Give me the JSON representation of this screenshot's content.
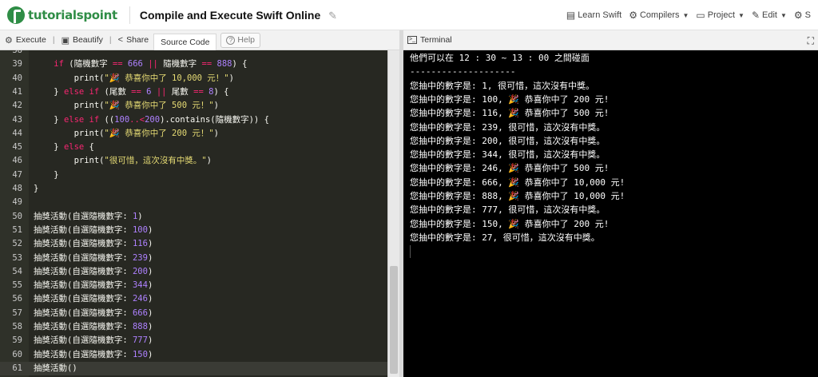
{
  "header": {
    "logo_text": "tutorialspoint",
    "title": "Compile and Execute Swift Online",
    "nav": [
      {
        "icon": "book-icon",
        "glyph": "▤",
        "label": "Learn Swift",
        "caret": false
      },
      {
        "icon": "gear-icon",
        "glyph": "⚙",
        "label": "Compilers",
        "caret": true
      },
      {
        "icon": "folder-icon",
        "glyph": "▭",
        "label": "Project",
        "caret": true
      },
      {
        "icon": "pencil-icon",
        "glyph": "✎",
        "label": "Edit",
        "caret": true
      },
      {
        "icon": "settings-icon",
        "glyph": "⚙",
        "label": "S",
        "caret": false
      }
    ]
  },
  "toolbar": {
    "execute_label": "Execute",
    "beautify_label": "Beautify",
    "share_label": "Share",
    "source_code_tab": "Source Code",
    "help_label": "Help"
  },
  "editor": {
    "active_line": 62,
    "lines": [
      {
        "n": "38",
        "segs": []
      },
      {
        "n": "39",
        "segs": [
          {
            "t": "    "
          },
          {
            "t": "if",
            "c": "kw"
          },
          {
            "t": " (隨機數字 "
          },
          {
            "t": "==",
            "c": "op"
          },
          {
            "t": " "
          },
          {
            "t": "666",
            "c": "num"
          },
          {
            "t": " "
          },
          {
            "t": "||",
            "c": "op"
          },
          {
            "t": " 隨機數字 "
          },
          {
            "t": "==",
            "c": "op"
          },
          {
            "t": " "
          },
          {
            "t": "888",
            "c": "num"
          },
          {
            "t": ") {"
          }
        ]
      },
      {
        "n": "40",
        "segs": [
          {
            "t": "        print("
          },
          {
            "t": "\"🎉 恭喜你中了 10,000 元！\"",
            "c": "str"
          },
          {
            "t": ")"
          }
        ]
      },
      {
        "n": "41",
        "segs": [
          {
            "t": "    } "
          },
          {
            "t": "else if",
            "c": "kw"
          },
          {
            "t": " (尾數 "
          },
          {
            "t": "==",
            "c": "op"
          },
          {
            "t": " "
          },
          {
            "t": "6",
            "c": "num"
          },
          {
            "t": " "
          },
          {
            "t": "||",
            "c": "op"
          },
          {
            "t": " 尾數 "
          },
          {
            "t": "==",
            "c": "op"
          },
          {
            "t": " "
          },
          {
            "t": "8",
            "c": "num"
          },
          {
            "t": ") {"
          }
        ]
      },
      {
        "n": "42",
        "segs": [
          {
            "t": "        print("
          },
          {
            "t": "\"🎉 恭喜你中了 500 元！\"",
            "c": "str"
          },
          {
            "t": ")"
          }
        ]
      },
      {
        "n": "43",
        "segs": [
          {
            "t": "    } "
          },
          {
            "t": "else if",
            "c": "kw"
          },
          {
            "t": " (("
          },
          {
            "t": "100",
            "c": "num"
          },
          {
            "t": "..<",
            "c": "op"
          },
          {
            "t": "200",
            "c": "num"
          },
          {
            "t": ").contains(隨機數字)) {"
          }
        ]
      },
      {
        "n": "44",
        "segs": [
          {
            "t": "        print("
          },
          {
            "t": "\"🎉 恭喜你中了 200 元！\"",
            "c": "str"
          },
          {
            "t": ")"
          }
        ]
      },
      {
        "n": "45",
        "segs": [
          {
            "t": "    } "
          },
          {
            "t": "else",
            "c": "kw"
          },
          {
            "t": " {"
          }
        ]
      },
      {
        "n": "46",
        "segs": [
          {
            "t": "        print("
          },
          {
            "t": "\"很可惜，這次沒有中獎。\"",
            "c": "str"
          },
          {
            "t": ")"
          }
        ]
      },
      {
        "n": "47",
        "segs": [
          {
            "t": "    }"
          }
        ]
      },
      {
        "n": "48",
        "segs": [
          {
            "t": "}"
          }
        ]
      },
      {
        "n": "49",
        "segs": []
      },
      {
        "n": "50",
        "segs": [
          {
            "t": "抽獎活動(自選隨機數字: "
          },
          {
            "t": "1",
            "c": "num"
          },
          {
            "t": ")"
          }
        ]
      },
      {
        "n": "51",
        "segs": [
          {
            "t": "抽獎活動(自選隨機數字: "
          },
          {
            "t": "100",
            "c": "num"
          },
          {
            "t": ")"
          }
        ]
      },
      {
        "n": "52",
        "segs": [
          {
            "t": "抽獎活動(自選隨機數字: "
          },
          {
            "t": "116",
            "c": "num"
          },
          {
            "t": ")"
          }
        ]
      },
      {
        "n": "53",
        "segs": [
          {
            "t": "抽獎活動(自選隨機數字: "
          },
          {
            "t": "239",
            "c": "num"
          },
          {
            "t": ")"
          }
        ]
      },
      {
        "n": "54",
        "segs": [
          {
            "t": "抽獎活動(自選隨機數字: "
          },
          {
            "t": "200",
            "c": "num"
          },
          {
            "t": ")"
          }
        ]
      },
      {
        "n": "55",
        "segs": [
          {
            "t": "抽獎活動(自選隨機數字: "
          },
          {
            "t": "344",
            "c": "num"
          },
          {
            "t": ")"
          }
        ]
      },
      {
        "n": "56",
        "segs": [
          {
            "t": "抽獎活動(自選隨機數字: "
          },
          {
            "t": "246",
            "c": "num"
          },
          {
            "t": ")"
          }
        ]
      },
      {
        "n": "57",
        "segs": [
          {
            "t": "抽獎活動(自選隨機數字: "
          },
          {
            "t": "666",
            "c": "num"
          },
          {
            "t": ")"
          }
        ]
      },
      {
        "n": "58",
        "segs": [
          {
            "t": "抽獎活動(自選隨機數字: "
          },
          {
            "t": "888",
            "c": "num"
          },
          {
            "t": ")"
          }
        ]
      },
      {
        "n": "59",
        "segs": [
          {
            "t": "抽獎活動(自選隨機數字: "
          },
          {
            "t": "777",
            "c": "num"
          },
          {
            "t": ")"
          }
        ]
      },
      {
        "n": "60",
        "segs": [
          {
            "t": "抽獎活動(自選隨機數字: "
          },
          {
            "t": "150",
            "c": "num"
          },
          {
            "t": ")"
          }
        ]
      },
      {
        "n": "61",
        "segs": [
          {
            "t": "抽獎活動()"
          }
        ]
      }
    ]
  },
  "terminal": {
    "title": "Terminal",
    "lines": [
      "他們可以在 12 : 30 ~ 13 : 00 之間碰面",
      "--------------------",
      "您抽中的數字是: 1, 很可惜，這次沒有中獎。",
      "您抽中的數字是: 100, 🎉 恭喜你中了 200 元!",
      "您抽中的數字是: 116, 🎉 恭喜你中了 500 元!",
      "您抽中的數字是: 239, 很可惜，這次沒有中獎。",
      "您抽中的數字是: 200, 很可惜，這次沒有中獎。",
      "您抽中的數字是: 344, 很可惜，這次沒有中獎。",
      "您抽中的數字是: 246, 🎉 恭喜你中了 500 元!",
      "您抽中的數字是: 666, 🎉 恭喜你中了 10,000 元!",
      "您抽中的數字是: 888, 🎉 恭喜你中了 10,000 元!",
      "您抽中的數字是: 777, 很可惜，這次沒有中獎。",
      "您抽中的數字是: 150, 🎉 恭喜你中了 200 元!",
      "您抽中的數字是: 27, 很可惜，這次沒有中獎。"
    ]
  },
  "colors": {
    "brand_green": "#2f8d46",
    "editor_bg": "#272822",
    "terminal_bg": "#000000",
    "keyword": "#f92672",
    "string": "#e6db74",
    "number": "#ae81ff"
  }
}
